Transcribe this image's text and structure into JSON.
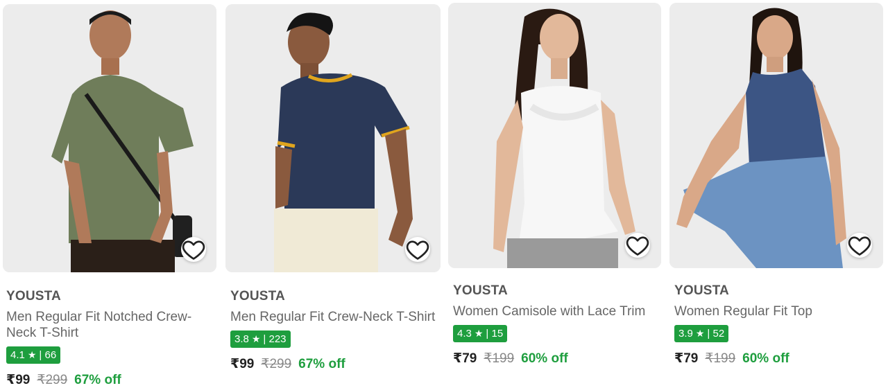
{
  "colors": {
    "rating_bg": "#1e9e3e",
    "discount_text": "#1e9e3e",
    "brand_text": "#555555"
  },
  "icons": {
    "wishlist": "heart-icon",
    "rating": "star-icon"
  },
  "products": [
    {
      "brand": "YOUSTA",
      "title": "Men Regular Fit Notched Crew-Neck T-Shirt",
      "rating": "4.1",
      "star": "★",
      "rating_count": "| 66",
      "price": "₹99",
      "mrp": "₹299",
      "discount": "67% off"
    },
    {
      "brand": "YOUSTA",
      "title": "Men Regular Fit Crew-Neck T-Shirt",
      "rating": "3.8",
      "star": "★",
      "rating_count": "| 223",
      "price": "₹99",
      "mrp": "₹299",
      "discount": "67% off"
    },
    {
      "brand": "YOUSTA",
      "title": "Women Camisole with Lace Trim",
      "rating": "4.3",
      "star": "★",
      "rating_count": "| 15",
      "price": "₹79",
      "mrp": "₹199",
      "discount": "60% off"
    },
    {
      "brand": "YOUSTA",
      "title": "Women Regular Fit Top",
      "rating": "3.9",
      "star": "★",
      "rating_count": "| 52",
      "price": "₹79",
      "mrp": "₹199",
      "discount": "60% off"
    }
  ]
}
